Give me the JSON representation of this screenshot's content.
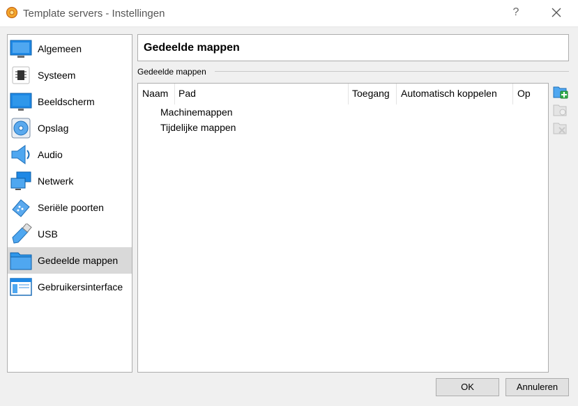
{
  "window": {
    "title": "Template servers - Instellingen",
    "help_glyph": "?",
    "app_icon": "virtualbox-icon",
    "close_icon": "close-icon"
  },
  "sidebar": {
    "items": [
      {
        "label": "Algemeen",
        "icon": "general-monitor-icon",
        "selected": false
      },
      {
        "label": "Systeem",
        "icon": "chip-icon",
        "selected": false
      },
      {
        "label": "Beeldscherm",
        "icon": "display-icon",
        "selected": false
      },
      {
        "label": "Opslag",
        "icon": "disk-icon",
        "selected": false
      },
      {
        "label": "Audio",
        "icon": "speaker-icon",
        "selected": false
      },
      {
        "label": "Netwerk",
        "icon": "network-icon",
        "selected": false
      },
      {
        "label": "Seriële poorten",
        "icon": "serial-port-icon",
        "selected": false
      },
      {
        "label": "USB",
        "icon": "usb-icon",
        "selected": false
      },
      {
        "label": "Gedeelde mappen",
        "icon": "shared-folder-icon",
        "selected": true
      },
      {
        "label": "Gebruikersinterface",
        "icon": "user-interface-icon",
        "selected": false
      }
    ]
  },
  "page": {
    "title": "Gedeelde mappen",
    "group_label": "Gedeelde mappen"
  },
  "table": {
    "columns": [
      "Naam",
      "Pad",
      "Toegang",
      "Automatisch koppelen",
      "Op"
    ],
    "items": [
      "Machinemappen",
      "Tijdelijke mappen"
    ]
  },
  "toolbar": {
    "add_icon": "add-shared-folder-icon",
    "edit_icon": "edit-shared-folder-icon",
    "remove_icon": "remove-shared-folder-icon"
  },
  "buttons": {
    "ok": "OK",
    "cancel": "Annuleren"
  },
  "colors": {
    "selection": "#d9d9d9",
    "accent_blue": "#1e88e5",
    "add_green": "#33b04a"
  }
}
